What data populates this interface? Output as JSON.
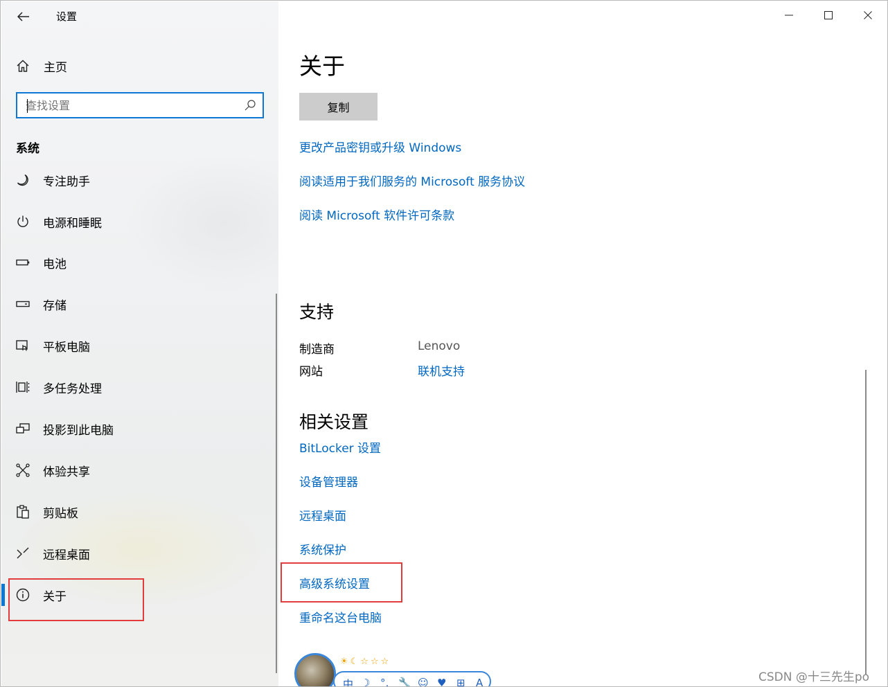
{
  "window": {
    "title": "设置",
    "controls": {
      "minimize": "—",
      "maximize": "☐",
      "close": "✕"
    }
  },
  "sidebar": {
    "home_label": "主页",
    "search_placeholder": "查找设置",
    "section_title": "系统",
    "items": [
      {
        "label": "专注助手",
        "icon": "moon-icon"
      },
      {
        "label": "电源和睡眠",
        "icon": "power-icon"
      },
      {
        "label": "电池",
        "icon": "battery-icon"
      },
      {
        "label": "存储",
        "icon": "storage-icon"
      },
      {
        "label": "平板电脑",
        "icon": "tablet-icon"
      },
      {
        "label": "多任务处理",
        "icon": "multitask-icon"
      },
      {
        "label": "投影到此电脑",
        "icon": "project-icon"
      },
      {
        "label": "体验共享",
        "icon": "share-icon"
      },
      {
        "label": "剪贴板",
        "icon": "clipboard-icon"
      },
      {
        "label": "远程桌面",
        "icon": "remote-desktop-icon"
      },
      {
        "label": "关于",
        "icon": "info-icon",
        "selected": true
      }
    ]
  },
  "content": {
    "title": "关于",
    "copy_button": "复制",
    "links_top": [
      "更改产品密钥或升级 Windows",
      "阅读适用于我们服务的 Microsoft 服务协议",
      "阅读 Microsoft 软件许可条款"
    ],
    "support": {
      "heading": "支持",
      "manufacturer_label": "制造商",
      "manufacturer_value": "Lenovo",
      "website_label": "网站",
      "website_link": "联机支持"
    },
    "related": {
      "heading": "相关设置",
      "links": [
        "BitLocker 设置",
        "设备管理器",
        "远程桌面",
        "系统保护",
        "高级系统设置",
        "重命名这台电脑"
      ]
    }
  },
  "overlay": {
    "badge_stars": "☀☾☆☆☆",
    "badge_chars": [
      "中",
      "☽",
      "°,",
      "🔧",
      "☺",
      "♥",
      "⊞",
      "A"
    ],
    "watermark": "CSDN @十三先生po"
  },
  "colors": {
    "accent": "#0a78d4",
    "link": "#0067c0",
    "highlight": "#e23b3b"
  }
}
